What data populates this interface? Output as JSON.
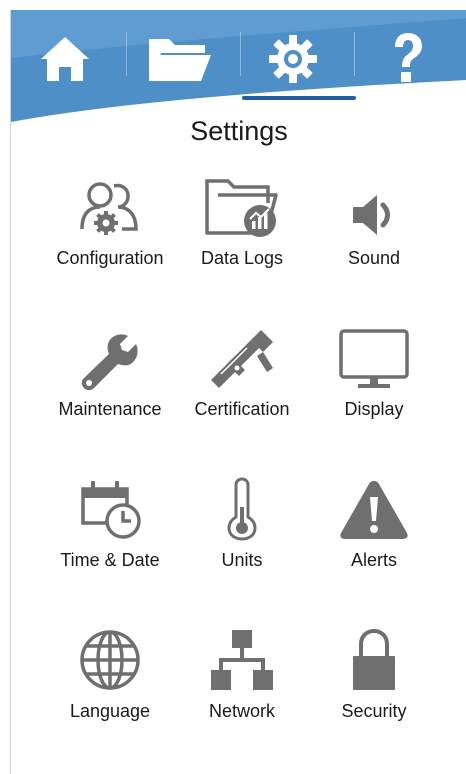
{
  "header": {
    "title": "Settings",
    "colors": {
      "bar": "#4f8fc7",
      "bar_light": "#6ea8da",
      "icon": "#ffffff",
      "active": "#1f5fa8"
    },
    "tabs": [
      {
        "icon": "home-icon"
      },
      {
        "icon": "folder-icon"
      },
      {
        "icon": "gear-icon",
        "active": true
      },
      {
        "icon": "help-icon"
      }
    ]
  },
  "settings": {
    "icon_color": "#6f6f6f",
    "items": [
      {
        "label": "Configuration",
        "icon": "users-gear-icon"
      },
      {
        "label": "Data Logs",
        "icon": "folder-chart-icon"
      },
      {
        "label": "Sound",
        "icon": "speaker-icon"
      },
      {
        "label": "Maintenance",
        "icon": "wrench-icon"
      },
      {
        "label": "Certification",
        "icon": "caliper-icon"
      },
      {
        "label": "Display",
        "icon": "monitor-icon"
      },
      {
        "label": "Time & Date",
        "icon": "calendar-clock-icon"
      },
      {
        "label": "Units",
        "icon": "thermometer-icon"
      },
      {
        "label": "Alerts",
        "icon": "warning-icon"
      },
      {
        "label": "Language",
        "icon": "globe-icon"
      },
      {
        "label": "Network",
        "icon": "network-icon"
      },
      {
        "label": "Security",
        "icon": "lock-icon"
      }
    ]
  }
}
